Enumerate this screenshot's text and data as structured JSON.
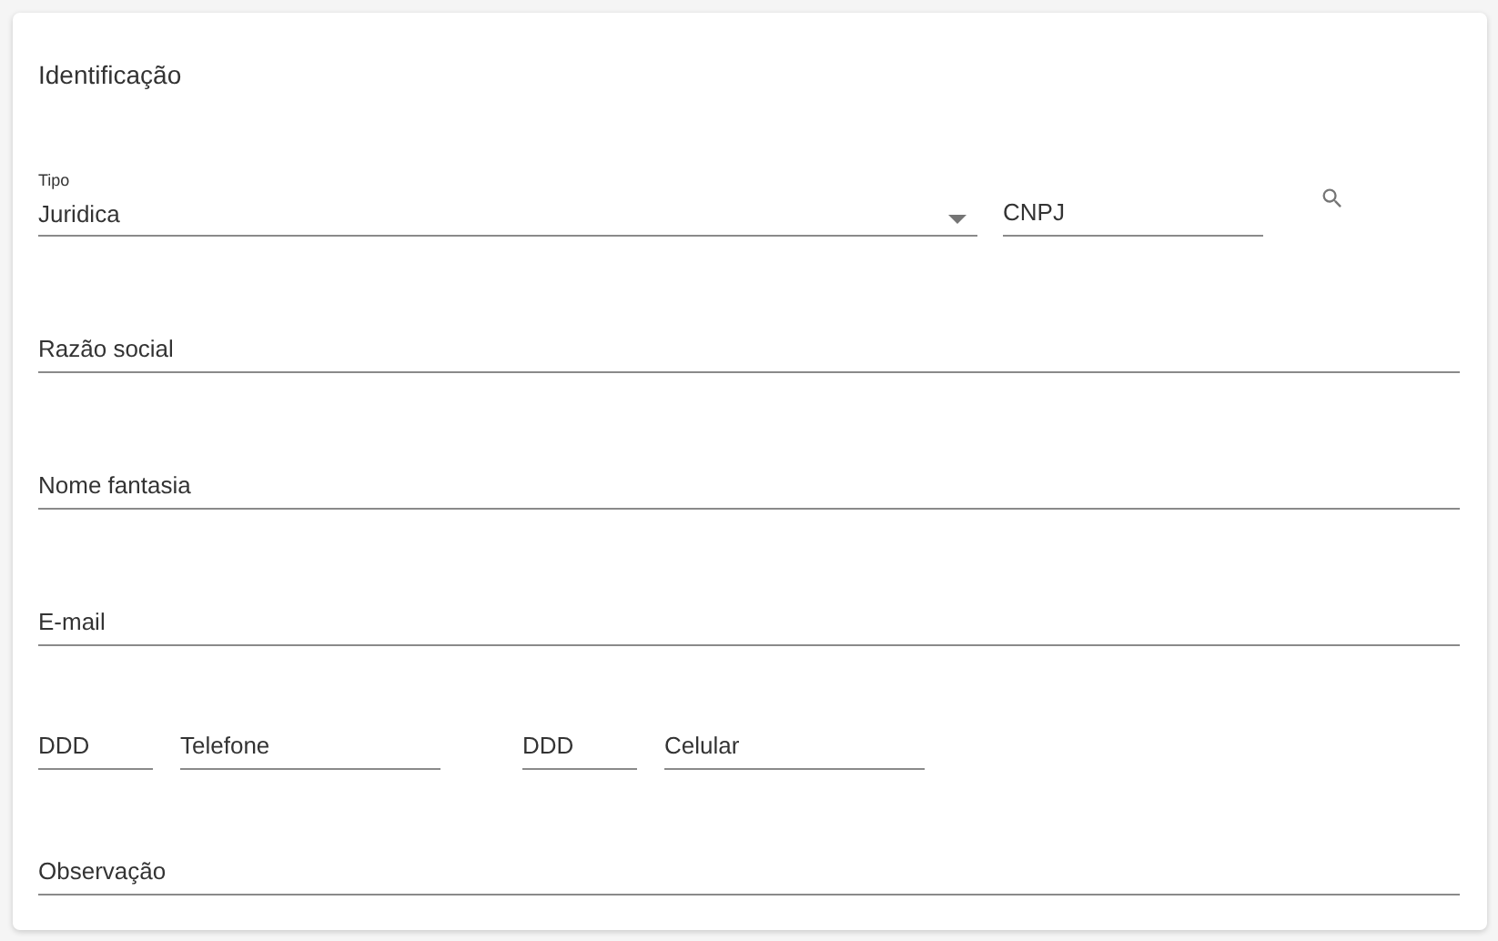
{
  "card": {
    "title": "Identificação"
  },
  "rows": [
    {
      "kind": "head",
      "fields": [
        {
          "kind": "select",
          "label": "Tipo",
          "value": "Juridica"
        },
        {
          "kind": "medium",
          "placeholder": "CNPJ"
        },
        {
          "kind": "search"
        }
      ]
    },
    {
      "kind": "single",
      "fields": [
        {
          "kind": "wide",
          "placeholder": "Razão social"
        }
      ]
    },
    {
      "kind": "single",
      "fields": [
        {
          "kind": "wide",
          "placeholder": "Nome fantasia"
        }
      ]
    },
    {
      "kind": "single",
      "fields": [
        {
          "kind": "wide",
          "placeholder": "E-mail"
        }
      ]
    },
    {
      "kind": "phones",
      "fields": [
        {
          "kind": "short",
          "placeholder": "DDD"
        },
        {
          "kind": "medium",
          "placeholder": "Telefone"
        },
        {
          "kind": "short",
          "placeholder": "DDD"
        },
        {
          "kind": "medium",
          "placeholder": "Celular"
        }
      ]
    },
    {
      "kind": "single",
      "fields": [
        {
          "kind": "wide",
          "placeholder": "Observação"
        }
      ]
    }
  ]
}
